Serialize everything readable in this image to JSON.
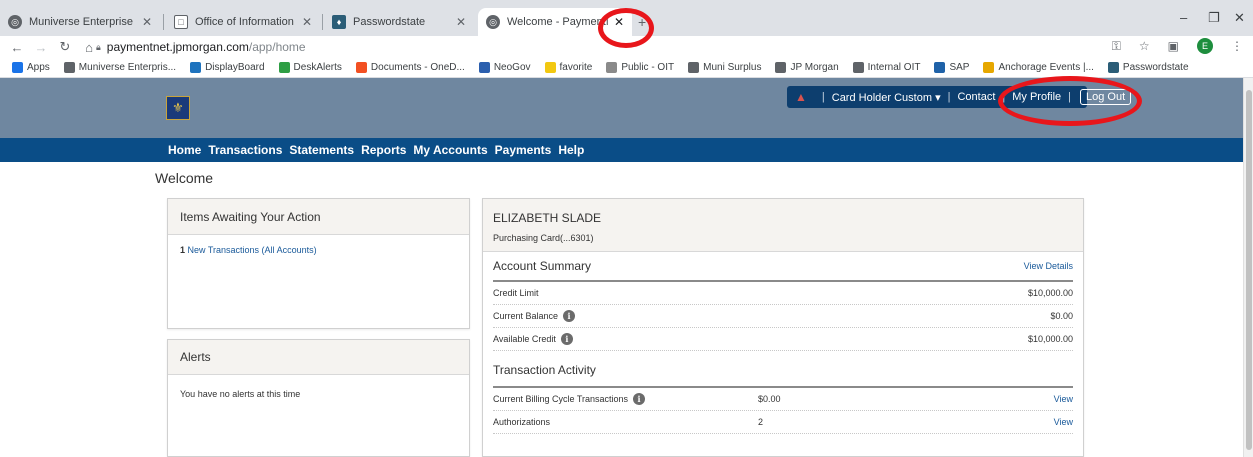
{
  "browser": {
    "tabs": [
      {
        "title": "Muniverse Enterprise Portal",
        "icon": "globe-icon",
        "active": false
      },
      {
        "title": "Office of Information Technology",
        "icon": "document-icon",
        "active": false
      },
      {
        "title": "Passwordstate",
        "icon": "passwordstate-icon",
        "active": false
      },
      {
        "title": "Welcome - PaymentNet - JP",
        "icon": "globe-icon",
        "active": true
      }
    ],
    "url": {
      "host": "paymentnet.jpmorgan.com",
      "path": "/app/home"
    },
    "profile_initial": "E",
    "bookmarks": [
      {
        "label": "Apps",
        "icon": "apps-grid-icon",
        "color": "#1a73e8"
      },
      {
        "label": "Muniverse Enterpris...",
        "icon": "globe-icon",
        "color": "#5f6368"
      },
      {
        "label": "DisplayBoard",
        "icon": "displayboard-icon",
        "color": "#1e73be"
      },
      {
        "label": "DeskAlerts",
        "icon": "deskalerts-icon",
        "color": "#2e9e44"
      },
      {
        "label": "Documents - OneD...",
        "icon": "microsoft-icon",
        "color": "#f25022"
      },
      {
        "label": "NeoGov",
        "icon": "neogov-icon",
        "color": "#2b5fae"
      },
      {
        "label": "favorite",
        "icon": "folder-icon",
        "color": "#f2c811"
      },
      {
        "label": "Public - OIT",
        "icon": "page-icon",
        "color": "#8a8a8a"
      },
      {
        "label": "Muni Surplus",
        "icon": "globe-icon",
        "color": "#5f6368"
      },
      {
        "label": "JP Morgan",
        "icon": "globe-icon",
        "color": "#5f6368"
      },
      {
        "label": "Internal OIT",
        "icon": "globe-icon",
        "color": "#5f6368"
      },
      {
        "label": "SAP",
        "icon": "sap-icon",
        "color": "#1f62a8"
      },
      {
        "label": "Anchorage Events |...",
        "icon": "sun-icon",
        "color": "#e6a700"
      },
      {
        "label": "Passwordstate",
        "icon": "passwordstate-icon",
        "color": "#2b5d77"
      }
    ]
  },
  "header": {
    "utility": {
      "role": "Card Holder Custom",
      "contact": "Contact",
      "profile": "My Profile",
      "logout": "Log Out"
    }
  },
  "nav": [
    "Home",
    "Transactions",
    "Statements",
    "Reports",
    "My Accounts",
    "Payments",
    "Help"
  ],
  "welcome": "Welcome",
  "items_awaiting": {
    "title": "Items Awaiting Your Action",
    "count": "1",
    "link": "New Transactions (All Accounts)"
  },
  "alerts": {
    "title": "Alerts",
    "message": "You have no alerts at this time"
  },
  "card": {
    "holder": "ELIZABETH SLADE",
    "name": "Purchasing Card(...6301)",
    "account_summary": {
      "title": "Account Summary",
      "view_details": "View Details",
      "rows": [
        {
          "label": "Credit Limit",
          "value": "$10,000.00",
          "info": false
        },
        {
          "label": "Current Balance",
          "value": "$0.00",
          "info": true
        },
        {
          "label": "Available Credit",
          "value": "$10,000.00",
          "info": true
        }
      ]
    },
    "transaction_activity": {
      "title": "Transaction Activity",
      "rows": [
        {
          "label": "Current Billing Cycle Transactions",
          "value": "$0.00",
          "action": "View",
          "info": true
        },
        {
          "label": "Authorizations",
          "value": "2",
          "action": "View",
          "info": false
        }
      ]
    }
  }
}
